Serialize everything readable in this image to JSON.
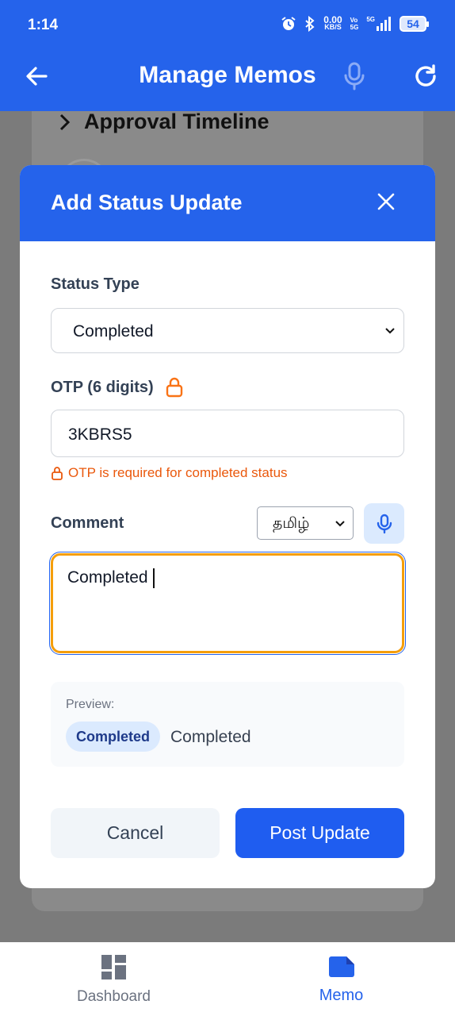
{
  "status_bar": {
    "time": "1:14",
    "speed_value": "0.00",
    "speed_unit": "KB/S",
    "volte_top": "Vo",
    "volte_bottom": "5G",
    "network": "5G",
    "battery": "54"
  },
  "app_bar": {
    "title": "Manage Memos",
    "icons": [
      "back-arrow-icon",
      "microphone-icon",
      "refresh-icon"
    ]
  },
  "background": {
    "section_title": "Approval Timeline"
  },
  "modal": {
    "title": "Add Status Update",
    "status_type_label": "Status Type",
    "status_type_value": "Completed",
    "otp_label": "OTP (6 digits)",
    "otp_value": "3KBRS5",
    "otp_hint": "OTP is required for completed status",
    "comment_label": "Comment",
    "language_value": "தமிழ்",
    "comment_value": "Completed",
    "preview_label": "Preview:",
    "preview_badge": "Completed",
    "preview_text": "Completed",
    "cancel_label": "Cancel",
    "post_label": "Post Update"
  },
  "bottom_nav": {
    "items": [
      {
        "label": "Dashboard",
        "active": false
      },
      {
        "label": "Memo",
        "active": true
      }
    ]
  },
  "colors": {
    "primary": "#2563eb",
    "warning": "#ea580c",
    "focus_border": "#f59e0b"
  }
}
